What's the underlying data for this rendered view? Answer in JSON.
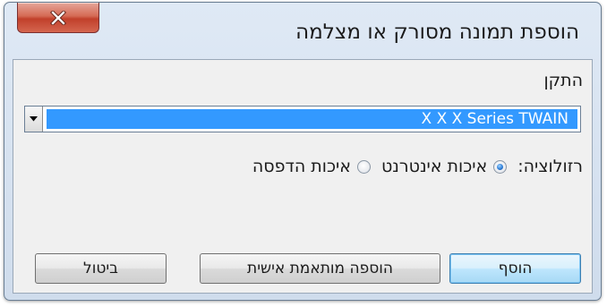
{
  "window": {
    "title": "הוספת תמונה מסורק או מצלמה",
    "close_icon": "close-x-icon"
  },
  "device": {
    "label": "התקן",
    "selected": "X X X Series TWAIN",
    "dropdown_icon": "chevron-down-icon"
  },
  "resolution": {
    "label": "רזולוציה:",
    "options": [
      {
        "label": "איכות אינטרנט",
        "selected": true
      },
      {
        "label": "איכות הדפסה",
        "selected": false
      }
    ]
  },
  "buttons": {
    "add": "הוסף",
    "custom_add": "הוספה מותאמת אישית",
    "cancel": "ביטול"
  },
  "colors": {
    "selection": "#3399ff",
    "close_button": "#c1402b",
    "default_button_border": "#3c7fb1"
  }
}
